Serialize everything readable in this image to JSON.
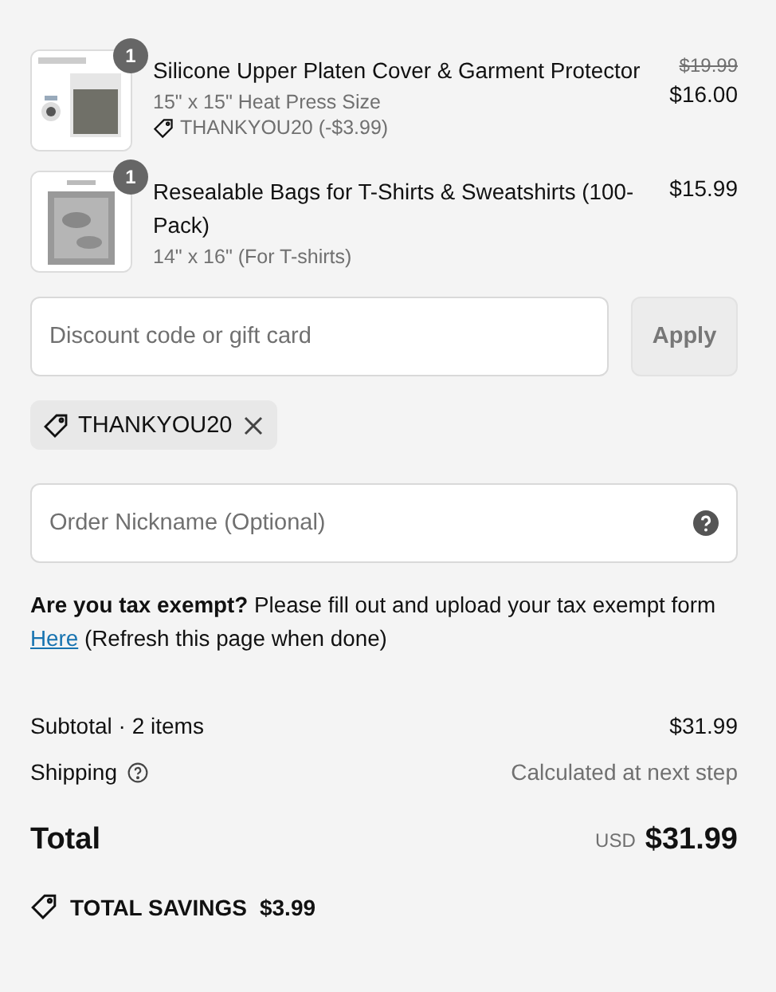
{
  "line_items": [
    {
      "quantity": "1",
      "name": "Silicone Upper Platen Cover & Garment Protector",
      "variant": "15\" x 15\" Heat Press Size",
      "discount": "THANKYOU20 (-$3.99)",
      "original_price": "$19.99",
      "price": "$16.00",
      "kind": "picture"
    },
    {
      "quantity": "1",
      "name": "Resealable Bags for T-Shirts & Sweatshirts (100-Pack)",
      "variant": "14\" x 16\" (For T-shirts)",
      "price": "$15.99",
      "kind": "picture"
    }
  ],
  "discount_field": {
    "placeholder": "Discount code or gift card",
    "button": "Apply",
    "disabled": true
  },
  "applied_codes": [
    {
      "code": "THANKYOU20"
    }
  ],
  "nickname_field": {
    "placeholder": "Order Nickname (Optional)"
  },
  "tax_note": {
    "text": "**Are you tax exempt?** Please fill out and upload your tax exempt form",
    "link": "Here",
    "after": "(Refresh this page when done)"
  },
  "summary": {
    "subtotal_label": "Subtotal · 2 items",
    "subtotal": "$31.99",
    "shipping_label": "Shipping",
    "shipping": "Calculated at next step",
    "total_label": "Total",
    "currency": "USD",
    "total": "$31.99",
    "savings_label": "TOTAL SAVINGS",
    "savings": "$3.99"
  }
}
